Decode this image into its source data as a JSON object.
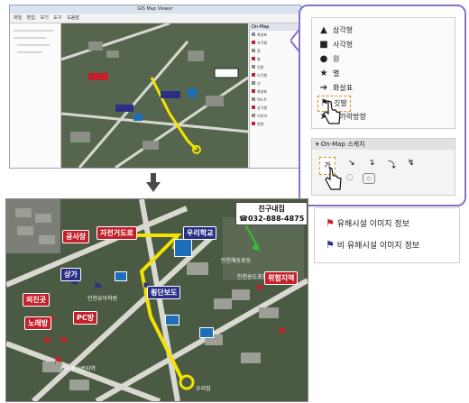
{
  "top_window": {
    "title": "GIS Map Viewer",
    "toolbar": [
      "파일",
      "편집",
      "보기",
      "도구",
      "도움말"
    ],
    "right_panel_header": "On-Map",
    "right_panel_items": [
      "화살표",
      "사각형",
      "원",
      "별",
      "깃발",
      "다각형",
      "선",
      "화살표",
      "텍스트",
      "삼각형",
      "이미지",
      "방향"
    ]
  },
  "shape_menu": {
    "items": [
      {
        "icon": "triangle-icon",
        "glyph": "▲",
        "label": "삼각형"
      },
      {
        "icon": "square-icon",
        "glyph": "■",
        "label": "사각형"
      },
      {
        "icon": "circle-icon",
        "glyph": "●",
        "label": "원"
      },
      {
        "icon": "star-icon",
        "glyph": "★",
        "label": "별"
      },
      {
        "icon": "arrow-icon",
        "glyph": "➔",
        "label": "화살표"
      },
      {
        "icon": "flag-icon",
        "glyph": "⚑",
        "label": "깃발"
      },
      {
        "icon": "compass-icon",
        "glyph": "➤",
        "label": "손가락방향"
      }
    ]
  },
  "sketch_panel": {
    "header": "On-Map 스케치",
    "tools": [
      "가",
      "↘",
      "↴",
      "⤵",
      "↯",
      "○",
      "◇"
    ]
  },
  "big_map": {
    "labels_red": [
      "공사장",
      "자전거도로",
      "위험지역",
      "외진곳",
      "노래방",
      "PC방"
    ],
    "labels_navy": [
      "우리학교",
      "횡단보도",
      "상가"
    ],
    "friend_house": "친구내집",
    "phone": "☎032-888-4875",
    "small_texts": [
      "인천해송초등",
      "인천유아학원",
      "우리집",
      "인천송도초등",
      "청라동 1번지역"
    ]
  },
  "legend": {
    "items": [
      {
        "color": "#c4202a",
        "label": "유해시설 이미지 정보"
      },
      {
        "color": "#2a2f86",
        "label": "비 유해시설 이미지 정보"
      }
    ]
  },
  "colors": {
    "callout_border": "#8a6fc7",
    "harmful": "#c4202a",
    "safe": "#2a2f86",
    "route": "#f2e400"
  }
}
